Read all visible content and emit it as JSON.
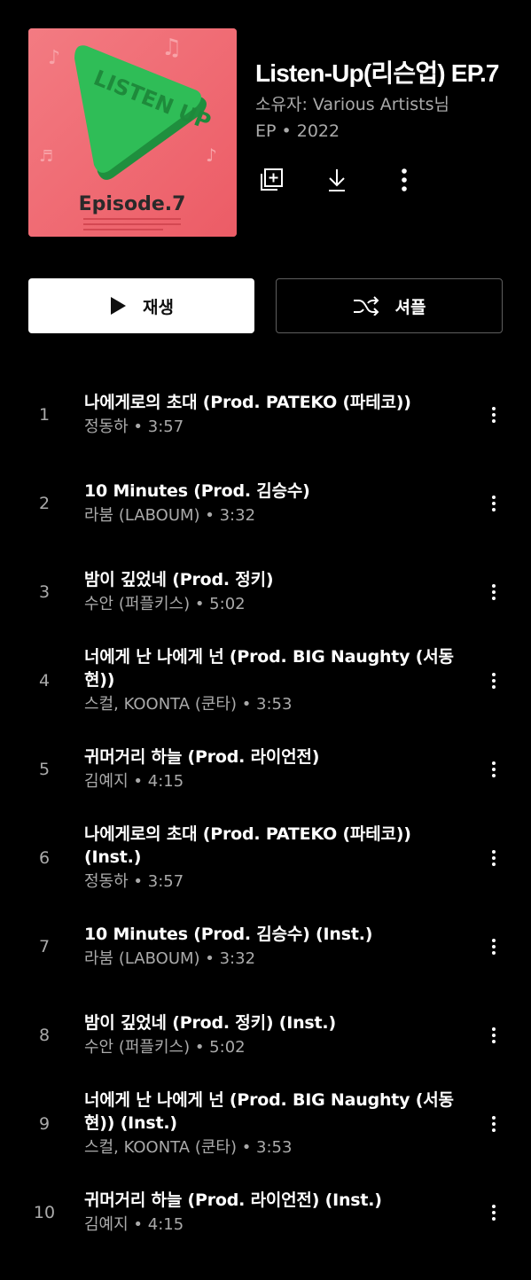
{
  "album": {
    "title": "Listen-Up(리슨업) EP.7",
    "owner": "소유자: Various Artists님",
    "meta": "EP • 2022",
    "cover": {
      "logo_text": "LISTEN UP",
      "episode_text": "Episode.7",
      "background_color": "#f06a72",
      "logo_color": "#27b452"
    }
  },
  "actions": {
    "save_icon": "add-to-library-icon",
    "download_icon": "download-icon",
    "more_icon": "more-vert-icon"
  },
  "buttons": {
    "play_label": "재생",
    "shuffle_label": "셔플"
  },
  "tracks": [
    {
      "num": "1",
      "title": "나에게로의 초대 (Prod. PATEKO (파테코))",
      "sub": "정동하 • 3:57"
    },
    {
      "num": "2",
      "title": "10 Minutes (Prod. 김승수)",
      "sub": "라붐 (LABOUM) • 3:32"
    },
    {
      "num": "3",
      "title": "밤이 깊었네 (Prod. 정키)",
      "sub": "수안 (퍼플키스) • 5:02"
    },
    {
      "num": "4",
      "title": "너에게 난 나에게 넌 (Prod. BIG Naughty (서동현))",
      "sub": "스컬, KOONTA (쿤타) • 3:53"
    },
    {
      "num": "5",
      "title": "귀머거리 하늘 (Prod. 라이언전)",
      "sub": "김예지 • 4:15"
    },
    {
      "num": "6",
      "title": "나에게로의 초대 (Prod. PATEKO (파테코)) (Inst.)",
      "sub": "정동하 • 3:57"
    },
    {
      "num": "7",
      "title": "10 Minutes (Prod. 김승수) (Inst.)",
      "sub": "라붐 (LABOUM) • 3:32"
    },
    {
      "num": "8",
      "title": "밤이 깊었네 (Prod. 정키) (Inst.)",
      "sub": "수안 (퍼플키스) • 5:02"
    },
    {
      "num": "9",
      "title": "너에게 난 나에게 넌 (Prod. BIG Naughty (서동현)) (Inst.)",
      "sub": "스컬, KOONTA (쿤타) • 3:53"
    },
    {
      "num": "10",
      "title": "귀머거리 하늘 (Prod. 라이언전) (Inst.)",
      "sub": "김예지 • 4:15"
    }
  ]
}
